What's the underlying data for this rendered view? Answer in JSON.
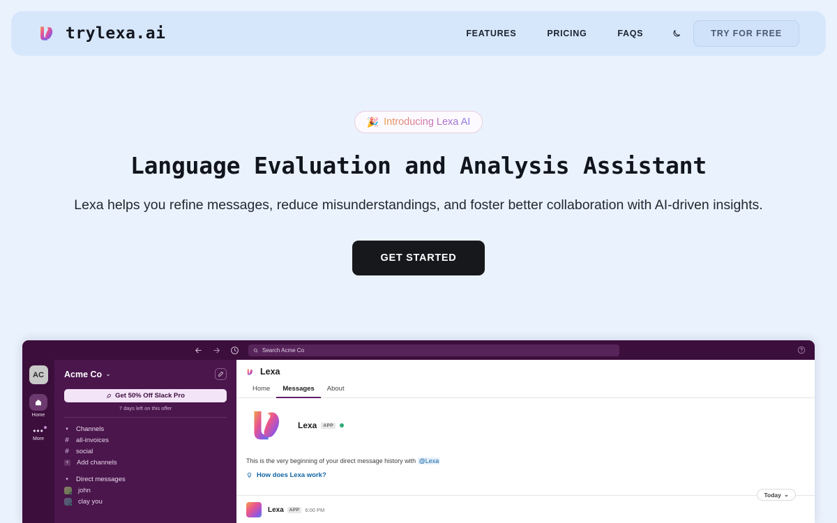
{
  "brand": {
    "name": "trylexa.ai",
    "logo_icon": "lexa-logo-mark"
  },
  "nav": {
    "links": [
      {
        "label": "FEATURES"
      },
      {
        "label": "PRICING"
      },
      {
        "label": "FAQS"
      }
    ],
    "theme_toggle_icon": "moon-icon",
    "cta_label": "TRY FOR FREE"
  },
  "hero": {
    "badge_emoji": "🎉",
    "badge_text": "Introducing Lexa AI",
    "headline": "Language Evaluation and Analysis Assistant",
    "subheadline": "Lexa helps you refine messages, reduce misunderstandings, and foster better collaboration with AI-driven insights.",
    "cta_label": "GET STARTED"
  },
  "app": {
    "topbar": {
      "back_icon": "arrow-left-icon",
      "forward_icon": "arrow-right-icon",
      "history_icon": "clock-icon",
      "search_icon": "search-icon",
      "search_placeholder": "Search Acme Co",
      "help_icon": "help-circle-icon"
    },
    "rail": {
      "workspace_initials": "AC",
      "items": [
        {
          "label": "Home",
          "icon": "home-icon"
        },
        {
          "label": "More",
          "icon": "more-dots-icon"
        }
      ]
    },
    "sidebar": {
      "workspace_name": "Acme Co",
      "workspace_caret": "⌄",
      "compose_icon": "compose-icon",
      "promo_icon": "rocket-icon",
      "promo_label": "Get 50% Off Slack Pro",
      "promo_sub": "7 days left on this offer",
      "channels_section": {
        "title": "Channels",
        "items": [
          {
            "label": "all-invoices",
            "icon": "hash-icon"
          },
          {
            "label": "social",
            "icon": "hash-icon"
          }
        ],
        "add_label": "Add channels",
        "add_icon": "plus-icon"
      },
      "dm_section": {
        "title": "Direct messages",
        "items": [
          {
            "label": "john"
          },
          {
            "label": "clay  you"
          }
        ]
      }
    },
    "main": {
      "title": "Lexa",
      "title_icon": "lexa-logo-mark",
      "tabs": [
        {
          "label": "Home",
          "active": false
        },
        {
          "label": "Messages",
          "active": true
        },
        {
          "label": "About",
          "active": false
        }
      ],
      "profile": {
        "name": "Lexa",
        "app_badge": "APP",
        "status": "online"
      },
      "intro_text_before": "This is the very beginning of your direct message history with ",
      "intro_mention": "@Lexa",
      "tip_icon": "lightbulb-icon",
      "tip_label": "How does Lexa work?",
      "day_divider": "Today",
      "day_divider_caret": "⌄",
      "last_message": {
        "name": "Lexa",
        "app_badge": "APP",
        "time": "6:00 PM"
      }
    }
  },
  "colors": {
    "page_bg": "#eaf2fd",
    "header_bg": "#d7e7fb",
    "cta_bg": "#17181b",
    "slack_purple": "#4a164c",
    "slack_dark": "#3c0e3c",
    "slack_accent": "#611f69",
    "link_blue": "#1264a3",
    "online_green": "#2bac76"
  }
}
